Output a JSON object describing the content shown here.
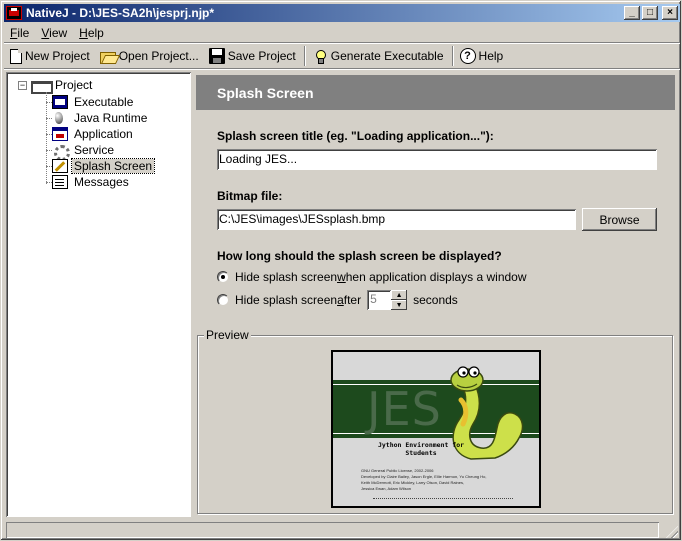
{
  "window": {
    "title": "NativeJ - D:\\JES-SA2h\\jesprj.njp*",
    "minimize": "_",
    "maximize": "□",
    "close": "×"
  },
  "menu": {
    "file": {
      "accel": "F",
      "rest": "ile"
    },
    "view": {
      "accel": "V",
      "rest": "iew"
    },
    "help": {
      "accel": "H",
      "rest": "elp"
    }
  },
  "toolbar": {
    "new_project": "New Project",
    "open_project": "Open Project...",
    "save_project": "Save Project",
    "generate_executable": "Generate Executable",
    "help": "Help",
    "help_glyph": "?"
  },
  "tree": {
    "root": "Project",
    "expander": "−",
    "items": [
      {
        "label": "Executable",
        "icon": "executable-icon"
      },
      {
        "label": "Java Runtime",
        "icon": "java-runtime-icon"
      },
      {
        "label": "Application",
        "icon": "application-icon"
      },
      {
        "label": "Service",
        "icon": "service-icon"
      },
      {
        "label": "Splash Screen",
        "icon": "splash-screen-icon",
        "selected": true
      },
      {
        "label": "Messages",
        "icon": "messages-icon"
      }
    ]
  },
  "panel": {
    "header": "Splash Screen",
    "title_label": "Splash screen title (eg. \"Loading application...\"):",
    "title_value": "Loading JES...",
    "bitmap_label": "Bitmap file:",
    "bitmap_value": "C:\\JES\\images\\JESsplash.bmp",
    "browse": "Browse",
    "duration_label": "How long should the splash screen be displayed?",
    "option_window": {
      "pre": "Hide splash screen ",
      "accel": "w",
      "post": "hen application displays a window"
    },
    "option_after": {
      "pre": "Hide splash screen ",
      "accel": "a",
      "post": "fter"
    },
    "seconds_value": "5",
    "seconds_label": "seconds",
    "spin_up": "▲",
    "spin_down": "▼",
    "preview_label": "Preview"
  },
  "splash_image": {
    "logo": "JES",
    "subtitle": "Jython Environment for Students",
    "lines": [
      "GNU General Public License, 2002-2006",
      "Developed by Claire Bailey, Jason Ergle, Ellie Harmon, Yu Cheung Ho,",
      "Keith McDermott, Eric Mickley, Larry Olson, David Raines,",
      "Jessica Ewan, Adam Wilson"
    ]
  },
  "colors": {
    "titlebar_start": "#0a246a",
    "titlebar_end": "#a6caf0",
    "header_bg": "#808080",
    "splash_band": "#1d4a1d"
  }
}
